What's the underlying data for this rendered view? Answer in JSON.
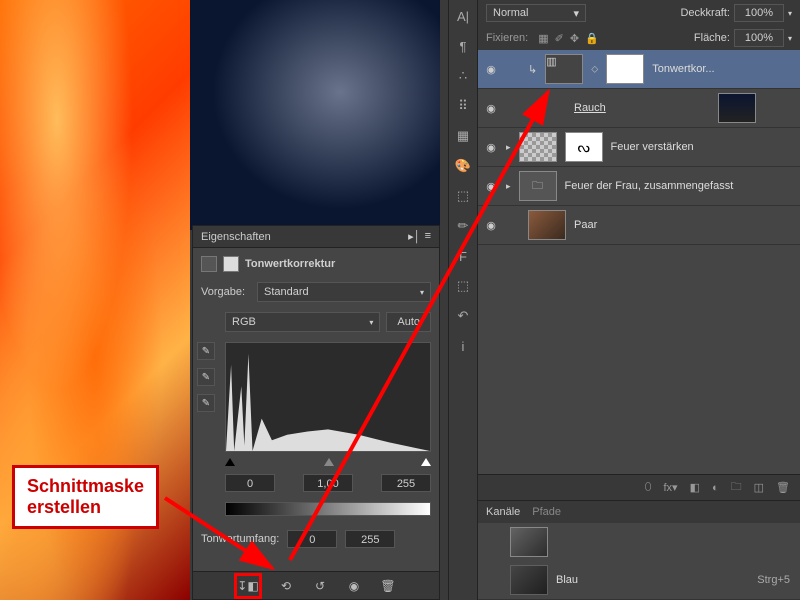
{
  "callout": "Schnittmaske\nerstellen",
  "properties": {
    "panel_title": "Eigenschaften",
    "adjustment_name": "Tonwertkorrektur",
    "preset_label": "Vorgabe:",
    "preset_value": "Standard",
    "channel_value": "RGB",
    "auto_label": "Auto",
    "input_black": "0",
    "input_gamma": "1,00",
    "input_white": "255",
    "output_label": "Tonwertumfang:",
    "output_black": "0",
    "output_white": "255"
  },
  "layers_panel": {
    "blend_mode": "Normal",
    "opacity_label": "Deckkraft:",
    "opacity_value": "100%",
    "lock_label": "Fixieren:",
    "fill_label": "Fläche:",
    "fill_value": "100%",
    "layers": [
      {
        "name": "Tonwertkor..."
      },
      {
        "name": "Rauch"
      },
      {
        "name": "Feuer verstärken"
      },
      {
        "name": "Feuer der Frau, zusammengefasst"
      },
      {
        "name": "Paar"
      }
    ]
  },
  "channels_panel": {
    "tab1": "Kanäle",
    "tab2": "Pfade",
    "channel_name": "Blau",
    "channel_shortcut": "Strg+5"
  }
}
